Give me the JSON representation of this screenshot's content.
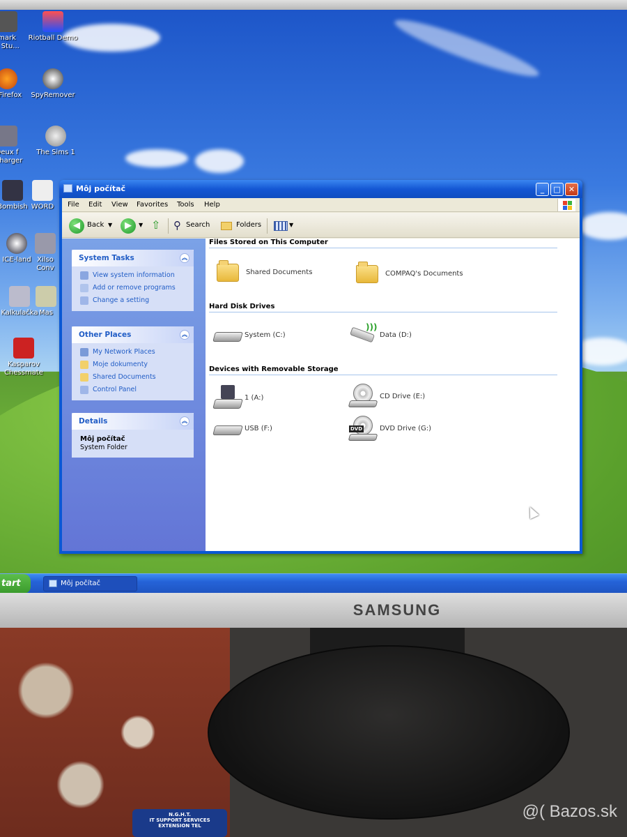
{
  "desktop": {
    "icons": [
      {
        "label": "mark\ng Stu..."
      },
      {
        "label": "Riotball Demo"
      },
      {
        "label": "a Firefox"
      },
      {
        "label": "SpyRemover"
      },
      {
        "label": "Deux f\nécharger"
      },
      {
        "label": "The Sims 1"
      },
      {
        "label": "Bombish"
      },
      {
        "label": "WORD"
      },
      {
        "label": "ICE-land"
      },
      {
        "label": "Xilso\nConv"
      },
      {
        "label": "Kalkulačka"
      },
      {
        "label": "Mas"
      },
      {
        "label": "Kasparov\nChessmate"
      }
    ]
  },
  "window": {
    "title": "Môj počítač",
    "controls": {
      "minimize": "_",
      "maximize": "□",
      "close": "✕"
    },
    "menu": [
      "File",
      "Edit",
      "View",
      "Favorites",
      "Tools",
      "Help"
    ],
    "toolbar": {
      "back": "Back",
      "search": "Search",
      "folders": "Folders"
    },
    "system_tasks": {
      "title": "System Tasks",
      "items": [
        "View system information",
        "Add or remove programs",
        "Change a setting"
      ]
    },
    "other_places": {
      "title": "Other Places",
      "items": [
        "My Network Places",
        "Moje dokumenty",
        "Shared Documents",
        "Control Panel"
      ]
    },
    "details": {
      "title": "Details",
      "name": "Môj počítač",
      "type": "System Folder"
    },
    "groups": [
      {
        "title": "Files Stored on This Computer",
        "items": [
          "Shared Documents",
          "COMPAQ's Documents"
        ]
      },
      {
        "title": "Hard Disk Drives",
        "items": [
          "System (C:)",
          "Data (D:)"
        ]
      },
      {
        "title": "Devices with Removable Storage",
        "items": [
          "1 (A:)",
          "CD Drive (E:)",
          "USB (F:)",
          "DVD Drive (G:)"
        ]
      }
    ]
  },
  "taskbar": {
    "start": "tart",
    "task": "Môj počítač"
  },
  "monitor": {
    "brand": "SAMSUNG"
  },
  "photo": {
    "watermark": "@( Bazos.sk",
    "sticker": "N.G.H.T.\nIT SUPPORT SERVICES\nEXTENSION TEL"
  },
  "colors": {
    "xp_blue": "#0a58d4",
    "taskpane": "#6375d6",
    "link": "#215dc6"
  }
}
